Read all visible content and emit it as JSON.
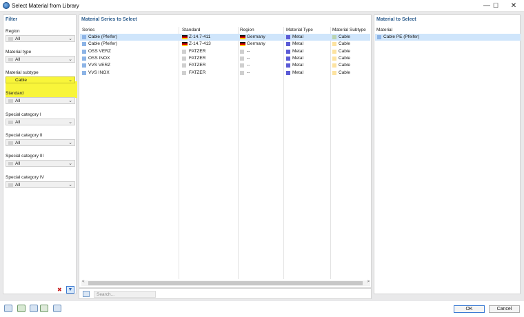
{
  "window": {
    "title": "Select Material from Library",
    "minimize": "—",
    "maximize": "☐",
    "close": "✕"
  },
  "filter": {
    "title": "Filter",
    "fields": [
      {
        "label": "Region",
        "value": "All"
      },
      {
        "label": "Material type",
        "value": "All"
      },
      {
        "label": "Material subtype",
        "value": "Cable",
        "highlighted": true
      },
      {
        "label": "Standard",
        "value": "All"
      },
      {
        "label": "Special category I",
        "value": "All"
      },
      {
        "label": "Special category II",
        "value": "All"
      },
      {
        "label": "Special category III",
        "value": "All"
      },
      {
        "label": "Special category IV",
        "value": "All"
      }
    ]
  },
  "series": {
    "title": "Material Series to Select",
    "columns": [
      "Series",
      "Standard",
      "Region",
      "Material Type",
      "Material Subtype"
    ],
    "rows": [
      {
        "series": "Cable (Pfeifer)",
        "standard": "Z-14.7-411",
        "region": "Germany",
        "type": "Metal",
        "subtype": "Cable",
        "selected": true
      },
      {
        "series": "Cable (Pfeifer)",
        "standard": "Z-14.7-413",
        "region": "Germany",
        "type": "Metal",
        "subtype": "Cable",
        "selected": false
      },
      {
        "series": "OSS VERZ",
        "standard": "FATZER",
        "region": "--",
        "type": "Metal",
        "subtype": "Cable",
        "selected": false
      },
      {
        "series": "OSS INOX",
        "standard": "FATZER",
        "region": "--",
        "type": "Metal",
        "subtype": "Cable",
        "selected": false
      },
      {
        "series": "VVS VERZ",
        "standard": "FATZER",
        "region": "--",
        "type": "Metal",
        "subtype": "Cable",
        "selected": false
      },
      {
        "series": "VVS INOX",
        "standard": "FATZER",
        "region": "--",
        "type": "Metal",
        "subtype": "Cable",
        "selected": false
      }
    ],
    "search_placeholder": "Search..."
  },
  "material": {
    "title": "Material to Select",
    "column": "Material",
    "rows": [
      "Cable PE (Pfeifer)"
    ]
  },
  "buttons": {
    "ok": "OK",
    "cancel": "Cancel"
  },
  "colors": {
    "accent": "#2f5f8f",
    "selection": "#cfe5fb",
    "highlight": "#f8f53a",
    "metal": "#5b5bd6",
    "cable_selected": "#b9d3b0",
    "cable": "#fde3a0",
    "series_icon": "#8db4e6"
  }
}
